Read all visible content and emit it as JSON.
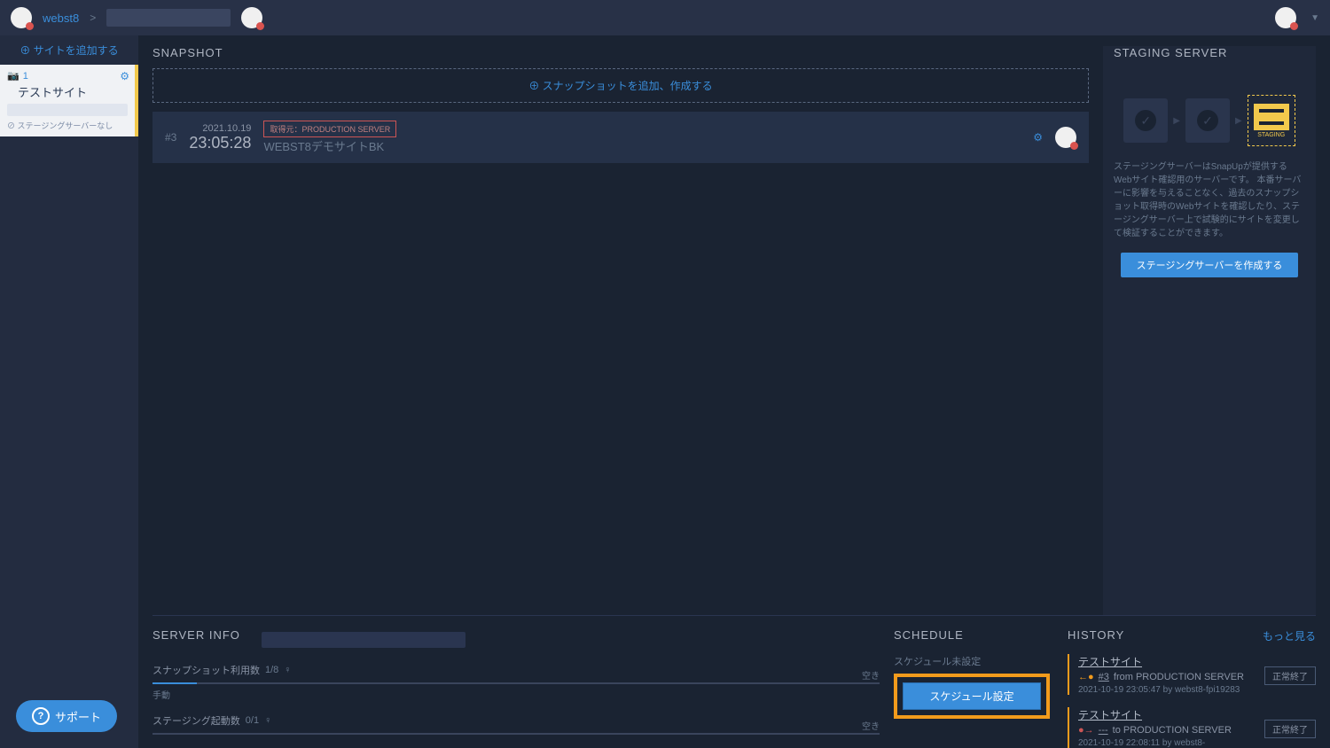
{
  "topbar": {
    "breadcrumb_link": "webst8",
    "breadcrumb_sep": ">"
  },
  "sidebar": {
    "add_site": "サイトを追加する",
    "site": {
      "count": "1",
      "name": "テストサイト",
      "note": "ステージングサーバーなし"
    }
  },
  "snapshot": {
    "title": "SNAPSHOT",
    "add_label": "スナップショットを追加、作成する",
    "item": {
      "idx": "#3",
      "date": "2021.10.19",
      "time": "23:05:28",
      "tag": "取得元：PRODUCTION SERVER",
      "name": "WEBST8デモサイトBK"
    }
  },
  "staging": {
    "title": "STAGING SERVER",
    "step_label": "STAGING",
    "desc": "ステージングサーバーはSnapUpが提供するWebサイト確認用のサーバーです。\n本番サーバーに影響を与えることなく、過去のスナップショット取得時のWebサイトを確認したり、ステージングサーバー上で試験的にサイトを変更して検証することができます。",
    "btn": "ステージングサーバーを作成する"
  },
  "server_info": {
    "title": "SERVER INFO",
    "snap_usage_label": "スナップショット利用数",
    "snap_usage_val": "1/8",
    "manual": "手動",
    "empty": "空き",
    "staging_count_label": "ステージング起動数",
    "staging_count_val": "0/1"
  },
  "schedule": {
    "title": "SCHEDULE",
    "text": "スケジュール未設定",
    "btn": "スケジュール設定"
  },
  "history": {
    "title": "HISTORY",
    "more": "もっと見る",
    "item1": {
      "title": "テストサイト",
      "id": "#3",
      "src": "from PRODUCTION SERVER",
      "meta": "2021-10-19 23:05:47  by  webst8-fpi19283",
      "status": "正常終了"
    },
    "item2": {
      "title": "テストサイト",
      "id": "---",
      "src": "to PRODUCTION SERVER",
      "meta": "2021-10-19 22:08:11  by  webst8-",
      "status": "正常終了"
    }
  },
  "support": "サポート"
}
